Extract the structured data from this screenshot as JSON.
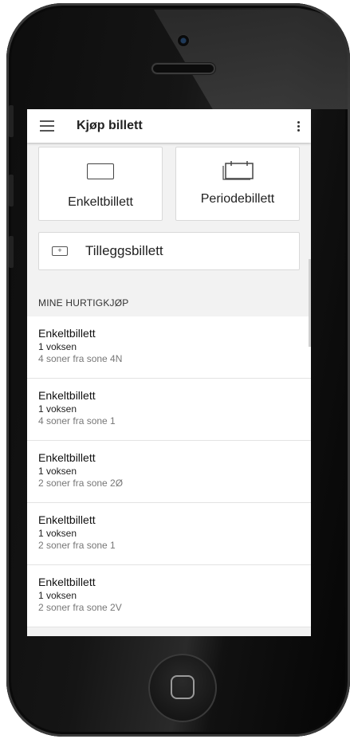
{
  "appbar": {
    "menu_icon": "hamburger-icon",
    "title": "Kjøp billett",
    "overflow_icon": "more-vert-icon"
  },
  "ticket_types": [
    {
      "label": "Enkeltbillett",
      "icon": "single-ticket-icon"
    },
    {
      "label": "Periodebillett",
      "icon": "period-ticket-icon"
    }
  ],
  "addon": {
    "label": "Tilleggsbillett",
    "icon": "addon-ticket-icon"
  },
  "quick_buys": {
    "header": "MINE HURTIGKJØP",
    "items": [
      {
        "title": "Enkeltbillett",
        "passenger": "1 voksen",
        "zones": "4 soner fra sone 4N"
      },
      {
        "title": "Enkeltbillett",
        "passenger": "1 voksen",
        "zones": "4 soner fra sone 1"
      },
      {
        "title": "Enkeltbillett",
        "passenger": "1 voksen",
        "zones": "2 soner fra sone 2Ø"
      },
      {
        "title": "Enkeltbillett",
        "passenger": "1 voksen",
        "zones": "2 soner fra sone 1"
      },
      {
        "title": "Enkeltbillett",
        "passenger": "1 voksen",
        "zones": "2 soner fra sone 2V"
      }
    ]
  }
}
